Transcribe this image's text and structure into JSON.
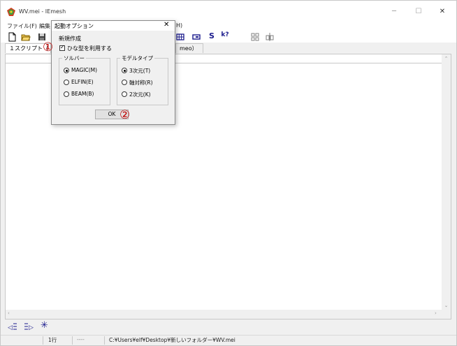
{
  "window": {
    "title": "WV.mei - IEmesh",
    "min_label": "─",
    "max_label": "☐",
    "close_label": "✕"
  },
  "menu": {
    "items": [
      "ファイル(F)",
      "編集",
      "H)"
    ]
  },
  "toolbar": {
    "icons": [
      "new-file-icon",
      "open-folder-icon",
      "save-icon",
      "grid-icon",
      "window-icon",
      "s-icon",
      "help-cursor-icon",
      "mesh-icon",
      "split-icon"
    ],
    "s_label": "S",
    "help_label": "k?"
  },
  "tabs": [
    {
      "label": "１スクリプト（"
    },
    {
      "label": "meo）"
    }
  ],
  "dialog": {
    "title": "起動オプション",
    "close_label": "✕",
    "section_label": "新規作成",
    "template_checkbox": {
      "label": "ひな型を利用する",
      "checked": true
    },
    "solver_group": {
      "title": "ソルバー",
      "options": [
        {
          "label": "MAGIC(M)",
          "selected": true
        },
        {
          "label": "ELFIN(E)",
          "selected": false
        },
        {
          "label": "BEAM(B)",
          "selected": false
        }
      ]
    },
    "model_group": {
      "title": "モデルタイプ",
      "options": [
        {
          "label": "3次元(T)",
          "selected": true
        },
        {
          "label": "軸対称(R)",
          "selected": false
        },
        {
          "label": "2次元(K)",
          "selected": false
        }
      ]
    },
    "ok_label": "OK"
  },
  "annotations": {
    "marker1": "①",
    "marker2": "②",
    "color": "#c00000"
  },
  "bottom_toolbar": {
    "icons": [
      "indent-icon",
      "outdent-icon",
      "asterisk-icon"
    ],
    "asterisk_label": "✳"
  },
  "status": {
    "line": "1行",
    "mode": "----",
    "path": "C:¥Users¥elf¥Desktop¥新しいフォルダー¥WV.mei"
  }
}
